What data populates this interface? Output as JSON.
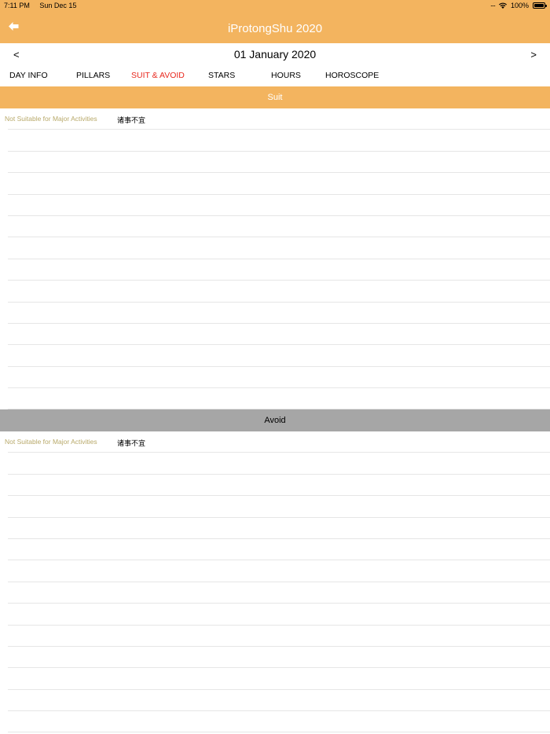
{
  "status_bar": {
    "time": "7:11 PM",
    "date": "Sun Dec 15",
    "signal": "....",
    "battery_percent": "100%",
    "icons": [
      "wifi-icon",
      "battery-icon"
    ]
  },
  "nav": {
    "title": "iProtongShu 2020",
    "back_icon": "back-arrow-icon"
  },
  "date_bar": {
    "prev": "<",
    "date": "01 January 2020",
    "next": ">"
  },
  "tabs": [
    {
      "label": "DAY INFO",
      "active": false
    },
    {
      "label": "PILLARS",
      "active": false
    },
    {
      "label": "SUIT & AVOID",
      "active": true
    },
    {
      "label": "STARS",
      "active": false
    },
    {
      "label": "HOURS",
      "active": false
    },
    {
      "label": "HOROSCOPE",
      "active": false
    }
  ],
  "suit": {
    "header": "Suit",
    "rows": [
      {
        "label": "Not Suitable for Major Activities",
        "value": "诸事不宜"
      }
    ]
  },
  "avoid": {
    "header": "Avoid",
    "rows": [
      {
        "label": "Not Suitable for Major Activities",
        "value": "诸事不宜"
      }
    ]
  },
  "colors": {
    "accent": "#f3b45f",
    "active_tab": "#e8281e",
    "avoid_header": "#a6a6a6",
    "row_label": "#b8a96a"
  }
}
